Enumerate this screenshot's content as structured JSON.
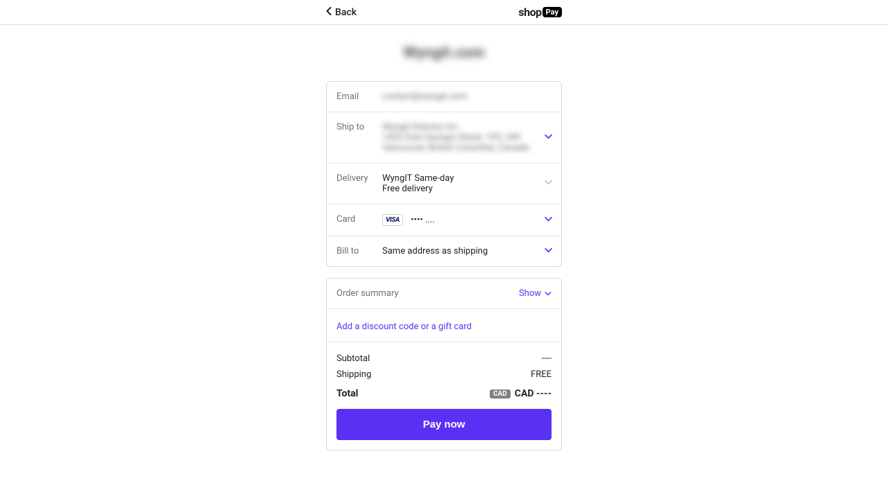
{
  "header": {
    "back_label": "Back",
    "pay_brand_prefix": "shop",
    "pay_brand_badge": "Pay"
  },
  "store_name": "Wyngit.com",
  "rows": {
    "email": {
      "label": "Email",
      "value": "contact@wyngit.com"
    },
    "shipto": {
      "label": "Ship to",
      "line1": "Wyngit Delivery Inc",
      "line2": "1453 East Georgia Street, 105, 249",
      "line3": "Vancouver, British Columbia, Canada"
    },
    "delivery": {
      "label": "Delivery",
      "line1": "WyngIT Same-day",
      "line2": "Free delivery"
    },
    "card": {
      "label": "Card",
      "brand": "VISA",
      "mask": "•••• ...."
    },
    "billto": {
      "label": "Bill to",
      "value": "Same address as shipping"
    }
  },
  "summary": {
    "label": "Order summary",
    "show_label": "Show",
    "discount_link": "Add a discount code or a gift card",
    "subtotal_label": "Subtotal",
    "subtotal_value": "----",
    "shipping_label": "Shipping",
    "shipping_value": "FREE",
    "total_label": "Total",
    "currency_badge": "CAD",
    "total_value": "CAD ----",
    "pay_button": "Pay now"
  }
}
